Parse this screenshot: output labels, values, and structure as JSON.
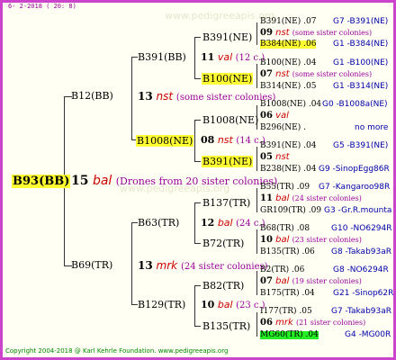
{
  "date": "6- 2-2018 ( 20: 8)",
  "root": {
    "label": "B93(BB)",
    "year": "15",
    "bal": "bal",
    "note": "(Drones from 20 sister colonies)"
  },
  "g1": [
    {
      "label": "B12(BB)",
      "year": "13",
      "bal": "nst",
      "note": "(some sister colonies)"
    },
    {
      "label": "B69(TR)",
      "year": "13",
      "bal": "mrk",
      "note": "(24 sister colonies)"
    }
  ],
  "g2": [
    {
      "label": "B391(BB)",
      "year": "11",
      "bal": "val",
      "note": "(12 c.)"
    },
    {
      "label": "B1008(NE)",
      "year": "08",
      "bal": "nst",
      "note": "(14 c.)"
    },
    {
      "label": "B63(TR)",
      "year": "12",
      "bal": "bal",
      "note": "(24 c.)"
    },
    {
      "label": "B129(TR)",
      "year": "10",
      "bal": "bal",
      "note": "(23 c.)"
    }
  ],
  "g3": [
    {
      "label": "B391(NE)"
    },
    {
      "label": "B100(NE)"
    },
    {
      "label": "B1008(NE)"
    },
    {
      "label": "B391(NE)"
    },
    {
      "label": "B137(TR)"
    },
    {
      "label": "B72(TR)"
    },
    {
      "label": "B82(TR)"
    },
    {
      "label": "B135(TR)"
    }
  ],
  "g4": [
    {
      "top": "B391(NE) .07",
      "topinfo": "G7 -B391(NE)",
      "year": "09",
      "bal": "nst",
      "note": "(some sister colonies)",
      "bottom": "B384(NE) .06",
      "bottominfo": "G1 -B384(NE)"
    },
    {
      "top": "B100(NE) .04",
      "topinfo": "G1 -B100(NE)",
      "year": "07",
      "bal": "nst",
      "note": "(some sister colonies)",
      "bottom": "B314(NE) .05",
      "bottominfo": "G1 -B314(NE)"
    },
    {
      "top": "B1008(NE) .04",
      "topinfo": "G0 -B1008a(NE)",
      "year": "06",
      "bal": "val",
      "note": "",
      "bottom": "B296(NE) .",
      "bottominfo": "no more"
    },
    {
      "top": "B391(NE) .04",
      "topinfo": "G5 -B391(NE)",
      "year": "05",
      "bal": "nst",
      "note": "",
      "bottom": "B238(NE) .04",
      "bottominfo": "G9 -SinopEgg86R"
    },
    {
      "top": "B55(TR) .09",
      "topinfo": "G7 -Kangaroo98R",
      "year": "11",
      "bal": "bal",
      "note": "(24 sister colonies)",
      "bottom": "GR109(TR) .09",
      "bottominfo": "G3 -Gr.R.mounta"
    },
    {
      "top": "B68(TR) .08",
      "topinfo": "G10 -NO6294R",
      "year": "10",
      "bal": "bal",
      "note": "(23 sister colonies)",
      "bottom": "B135(TR) .06",
      "bottominfo": "G8 -Takab93aR"
    },
    {
      "top": "B2(TR) .06",
      "topinfo": "G8 -NO6294R",
      "year": "07",
      "bal": "bal",
      "note": "(19 sister colonies)",
      "bottom": "B175(TR) .04",
      "bottominfo": "G21 -Sinop62R"
    },
    {
      "top": "I177(TR) .05",
      "topinfo": "G7 -Takab93aR",
      "year": "06",
      "bal": "mrk",
      "note": "(21 sister colonies)",
      "bottom": "MG60(TR) .04",
      "bottominfo": "G4 -MG00R"
    }
  ],
  "watermarks": [
    "www.pedigreeapis.org",
    "www.pedigreeapis.org"
  ],
  "copyright": "Copyright 2004-2018 @ Karl Kehrle Foundation.   www.pedigreeapis.org",
  "colors": {
    "border": "#cc44cc",
    "highlight": "#ffff33",
    "highlight_green": "#22ee22",
    "bal": "#cc0000",
    "note": "#990099",
    "info": "#0000aa"
  }
}
